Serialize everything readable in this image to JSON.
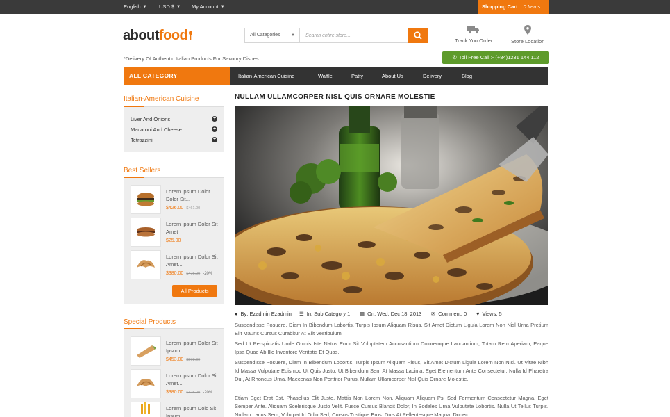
{
  "topbar": {
    "language": "English",
    "currency": "USD $",
    "account": "My Account",
    "cart_label": "Shopping Cart",
    "cart_count": "0 Items"
  },
  "header": {
    "logo_part1": "about",
    "logo_part2": "food",
    "tagline": "*Delivery Of Authentic Italian Products For Savoury Dishes",
    "search_category": "All Categories",
    "search_placeholder": "Search entire store...",
    "track_order": "Track You Order",
    "store_location": "Store Location",
    "toll_free": "Toll Free Call :- (+84)1231 144 112"
  },
  "nav": {
    "all_category": "ALL CATEGORY",
    "items": [
      "Italian-American Cuisine",
      "Waffle",
      "Patty",
      "About Us",
      "Delivery",
      "Blog"
    ]
  },
  "sidebar": {
    "category_title": "Italian-American Cuisine",
    "categories": [
      "Liver And Onions",
      "Macaroni And Cheese",
      "Tetrazzini"
    ],
    "bestsellers_title": "Best Sellers",
    "bestsellers": [
      {
        "name": "Lorem Ipsum Dolor Dolor Sit...",
        "price": "$426.00",
        "old": "$461.00",
        "off": ""
      },
      {
        "name": "Lorem Ipsum Dolor Sit Amet",
        "price": "$25.00",
        "old": "",
        "off": ""
      },
      {
        "name": "Lorem Ipsum Dolor Sit Amet...",
        "price": "$380.00",
        "old": "$475.00",
        "off": "-20%"
      }
    ],
    "all_products": "All Products",
    "special_title": "Special Products",
    "special": [
      {
        "name": "Lorem Ipsum Dolor Sit Ipsum...",
        "price": "$453.00",
        "old": "$578.00",
        "off": ""
      },
      {
        "name": "Lorem Ipsum Dolor Sit Amet...",
        "price": "$380.00",
        "old": "$475.00",
        "off": "-20%"
      },
      {
        "name": "Lorem Ipsum Dolo Sit Ipsum...",
        "price": "",
        "old": "",
        "off": ""
      }
    ]
  },
  "post": {
    "title": "NULLAM ULLAMCORPER NISL QUIS ORNARE MOLESTIE",
    "author": "By: Ezadmin Ezadmin",
    "category": "In: Sub Category 1",
    "date": "On: Wed, Dec 18, 2013",
    "comments": "Comment: 0",
    "views": "Views: 5",
    "paragraphs": [
      "Suspendisse Posuere, Diam In Bibendum Lobortis, Turpis Ipsum Aliquam Risus, Sit Amet Dictum Ligula Lorem Non Nisl Urna Pretium Elit Mauris Cursus Curabitur At Elit Vestibulum",
      "Sed Ut Perspiciatis Unde Omnis Iste Natus Error Sit Voluptatem Accusantium Doloremque Laudantium, Totam Rem Aperiam, Eaque Ipsa Quae Ab Illo Inventore Veritatis Et Quas.",
      "Suspendisse Posuere, Diam In Bibendum Lobortis, Turpis Ipsum Aliquam Risus, Sit Amet Dictum Ligula Lorem Non Nisl. Ut Vitae Nibh Id Massa Vulputate Euismod Ut Quis Justo. Ut Bibendum Sem At Massa Lacinia. Eget Elementum Ante Consectetur, Nulla Id Pharetra Dui, At Rhoncus Urna. Maecenas Non Porttitor Purus. Nullam Ullamcorper Nisl Quis Ornare Molestie.",
      "Etiam Eget Erat Est. Phasellus Elit Justo, Mattis Non Lorem Non, Aliquam Aliquam Ps. Sed Fermentum Consectetur Magna, Eget Semper Ante. Aliquam Scelerisque Justo Velit. Fusce Cursus Blandit Dolor, In Sodales Urna Vulputate Lobortis. Nulla Ut Tellus Turpis. Nullam Lacus Sem, Volutpat Id Odio Sed, Cursus Tristique Eros. Duis At Pellentesque Magna. Donec"
    ]
  },
  "colors": {
    "accent": "#f0780f",
    "topbar": "#3a3a3a",
    "nav": "#333333",
    "tollfree": "#5e9b2b",
    "sidebar_bg": "#eeeeee"
  },
  "icons": [
    "chevron-down-icon",
    "search-icon",
    "truck-icon",
    "map-pin-icon",
    "phone-icon",
    "plus-circle-icon",
    "user-icon",
    "list-icon",
    "calendar-icon",
    "comments-icon",
    "heart-icon"
  ]
}
